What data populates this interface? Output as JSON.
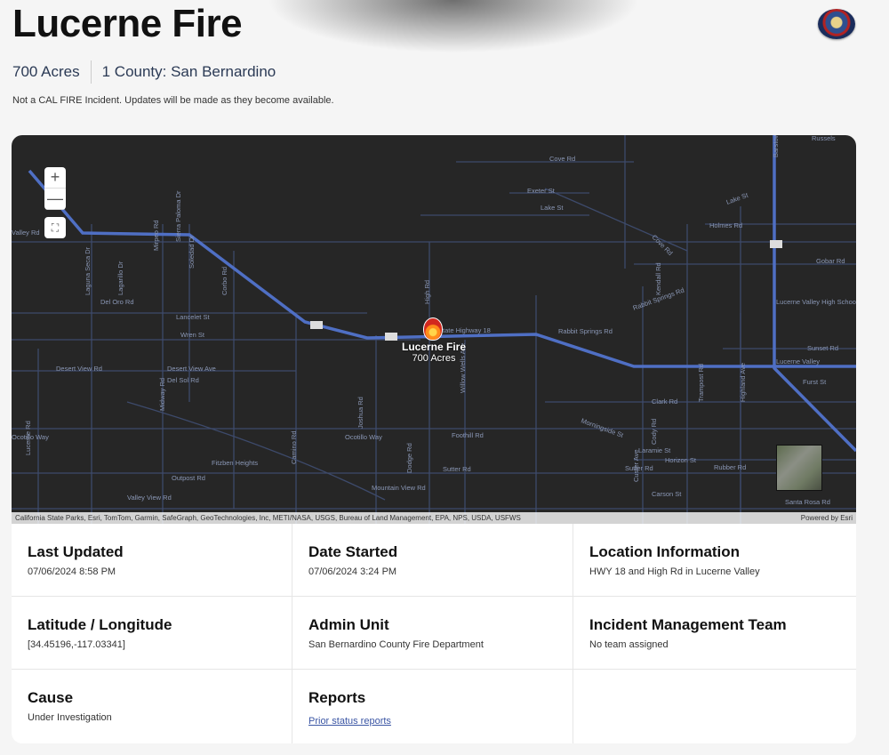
{
  "incident": {
    "title": "Lucerne Fire",
    "acres": "700 Acres",
    "county": "1 County: San Bernardino",
    "notice": "Not a CAL FIRE Incident. Updates will be made as they become available."
  },
  "map": {
    "zoom_in": "+",
    "zoom_out": "—",
    "fire_name": "Lucerne Fire",
    "fire_acres": "700 Acres",
    "attribution": "California State Parks, Esri, TomTom, Garmin, SafeGraph, GeoTechnologies, Inc, METI/NASA, USGS, Bureau of Land Management, EPA, NPS, USDA, USFWS",
    "powered_by": "Powered by Esri",
    "labels": [
      "State Highway 18",
      "Cove Rd",
      "Exeter St",
      "Lake St",
      "Holmes Rd",
      "Cove Rd",
      "Gobar Rd",
      "Russels",
      "Barstow Rd",
      "Lake St",
      "Lucerne Valley High School",
      "Sunset Rd",
      "Lucerne Valley",
      "Furst St",
      "Del Oro Rd",
      "Lancelet St",
      "Wren St",
      "Desert View Rd",
      "Desert View Ave",
      "Del Sol Rd",
      "Rabbit Springs Rd",
      "Rabbit Springs Rd",
      "Clark Rd",
      "Laramie St",
      "Horizon St",
      "Sutter Rd",
      "Carson St",
      "Santa Rosa Rd",
      "Foothill Rd",
      "Sutter Rd",
      "Mountain View Rd",
      "Valley View Rd",
      "Outpost Rd",
      "Fitzben Heights",
      "Ocotillo Way",
      "Ocotillo Way",
      "Morningside St",
      "High Rd",
      "Willow Wells Ave",
      "Joshua Rd",
      "Dodge Rd",
      "Kendall Rd",
      "Trampost Rd",
      "Highland Ave",
      "Custer Ave",
      "Cody Rd",
      "Sierra Paloma Dr",
      "Mirpeo Rd",
      "Soledad Dr",
      "Laguna Seca Dr",
      "Lagarillo Dr",
      "Corbo Rd",
      "Midway Rd",
      "Camino Rd",
      "Lucerne Rd",
      "Rubber Rd",
      "Valley Rd"
    ]
  },
  "details": [
    {
      "label": "Last Updated",
      "value": "07/06/2024 8:58 PM"
    },
    {
      "label": "Date Started",
      "value": "07/06/2024 3:24 PM"
    },
    {
      "label": "Location Information",
      "value": "HWY 18 and High Rd in Lucerne Valley"
    },
    {
      "label": "Latitude / Longitude",
      "value": "[34.45196,-117.03341]"
    },
    {
      "label": "Admin Unit",
      "value": "San Bernardino County Fire Department"
    },
    {
      "label": "Incident Management Team",
      "value": "No team assigned"
    },
    {
      "label": "Cause",
      "value": "Under Investigation"
    },
    {
      "label": "Reports",
      "link": "Prior status reports"
    }
  ],
  "colors": {
    "map_background": "#262626",
    "highway": "#4f6fc4",
    "road": "#3d4a6b"
  }
}
